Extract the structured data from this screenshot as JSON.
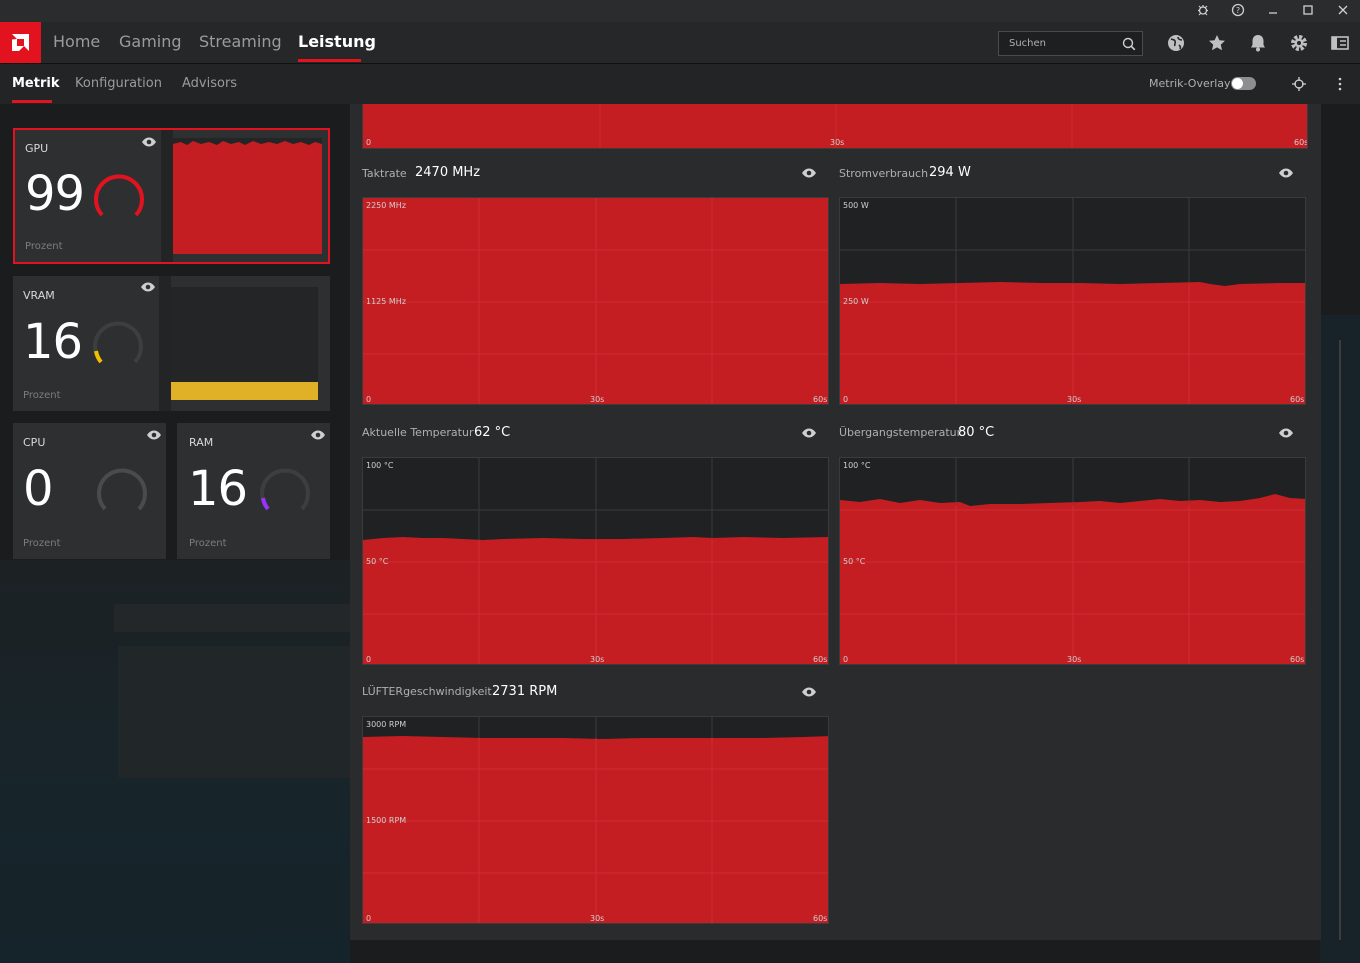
{
  "nav": {
    "items": [
      "Home",
      "Gaming",
      "Streaming",
      "Leistung"
    ],
    "active": "Leistung",
    "search_placeholder": "Suchen"
  },
  "subnav": {
    "items": [
      "Metrik",
      "Konfiguration",
      "Advisors"
    ],
    "active": "Metrik",
    "overlay_label": "Metrik-Overlay",
    "overlay_enabled": false
  },
  "cards": {
    "gpu": {
      "title": "GPU",
      "value": "99",
      "unit": "Prozent",
      "gauge_color": "#e2121f",
      "gauge_fraction": 0.99
    },
    "vram": {
      "title": "VRAM",
      "value": "16",
      "unit": "Prozent",
      "gauge_color": "#f0c000",
      "gauge_fraction": 0.16
    },
    "cpu": {
      "title": "CPU",
      "value": "0",
      "unit": "Prozent",
      "gauge_color": "#555658",
      "gauge_fraction": 0.0
    },
    "ram": {
      "title": "RAM",
      "value": "16",
      "unit": "Prozent",
      "gauge_color": "#9b30ff",
      "gauge_fraction": 0.16
    }
  },
  "metrics": {
    "top": {
      "ticks": {
        "zero": "0",
        "mid": "30s",
        "end": "60s"
      }
    },
    "clock": {
      "label": "Taktrate",
      "value": "2470 MHz",
      "ymax_label": "2250 MHz",
      "ymid_label": "1125 MHz",
      "zero": "0",
      "mid": "30s",
      "end": "60s"
    },
    "power": {
      "label": "Stromverbrauch",
      "value": "294 W",
      "ymax_label": "500 W",
      "ymid_label": "250 W",
      "zero": "0",
      "mid": "30s",
      "end": "60s"
    },
    "temp": {
      "label": "Aktuelle Temperatur",
      "value": "62 °C",
      "ymax_label": "100 °C",
      "ymid_label": "50 °C",
      "zero": "0",
      "mid": "30s",
      "end": "60s"
    },
    "junction": {
      "label": "Übergangstemperatur",
      "value": "80 °C",
      "ymax_label": "100 °C",
      "ymid_label": "50 °C",
      "zero": "0",
      "mid": "30s",
      "end": "60s"
    },
    "fan": {
      "label": "LÜFTERgeschwindigkeit",
      "value": "2731 RPM",
      "ymax_label": "3000 RPM",
      "ymid_label": "1500 RPM",
      "zero": "0",
      "mid": "30s",
      "end": "60s"
    }
  },
  "colors": {
    "accent": "#e2121f",
    "chart_fill": "#c41e22",
    "vram_bar": "#e0b026"
  }
}
